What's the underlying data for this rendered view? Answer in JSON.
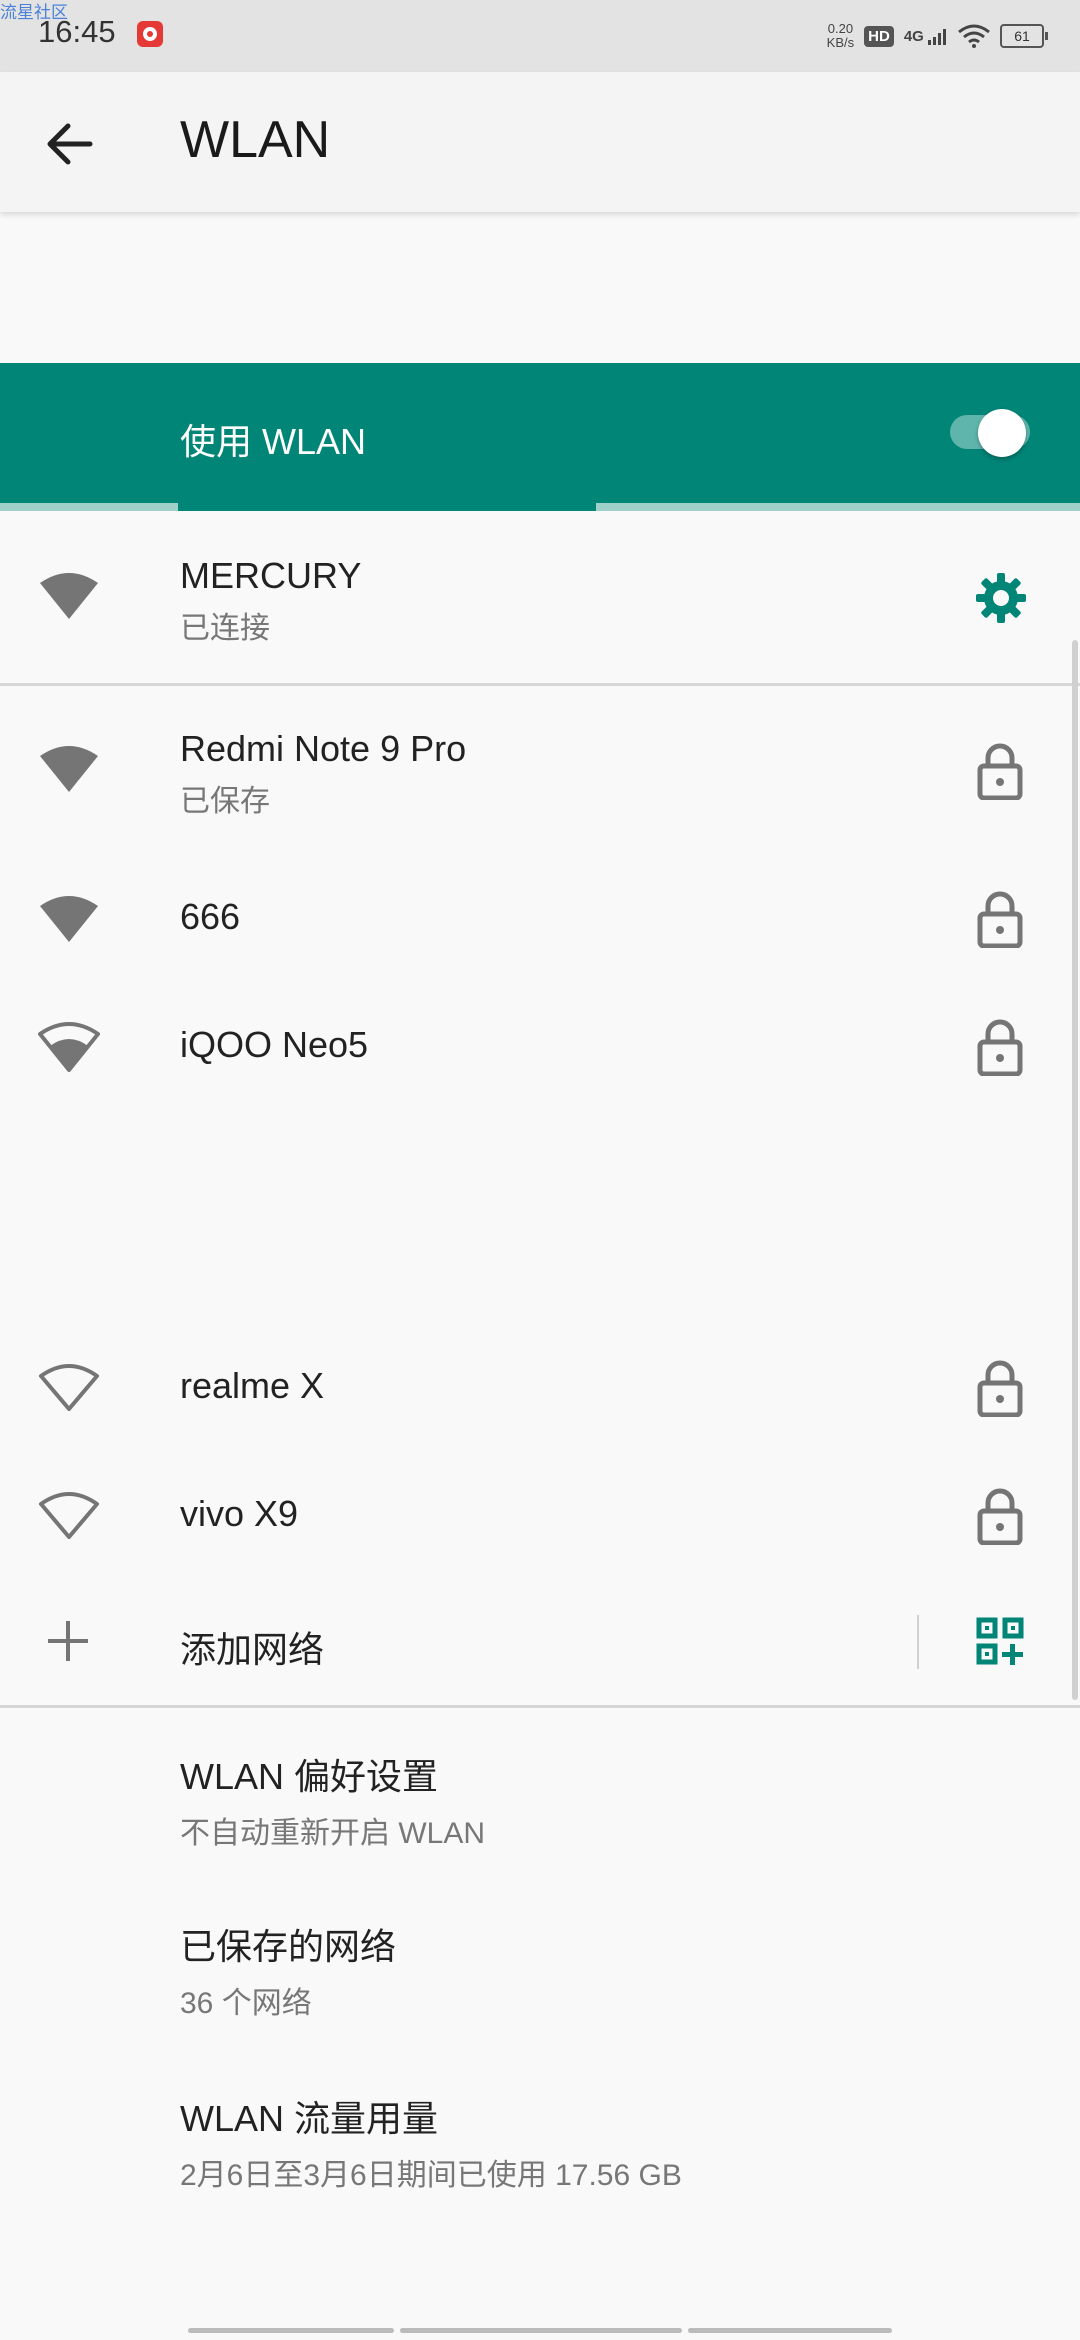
{
  "status_bar": {
    "watermark": "流星社区",
    "time": "16:45",
    "speed_value": "0.20",
    "speed_unit": "KB/s",
    "hd": "HD",
    "network": "4G",
    "battery": "61"
  },
  "app_bar": {
    "title": "WLAN"
  },
  "master_switch": {
    "label": "使用 WLAN",
    "enabled": true
  },
  "connected": {
    "name": "MERCURY",
    "status": "已连接"
  },
  "networks": [
    {
      "name": "Redmi Note 9 Pro",
      "status": "已保存",
      "signal": "full",
      "secured": true
    },
    {
      "name": "666",
      "status": "",
      "signal": "full",
      "secured": true
    },
    {
      "name": "iQOO Neo5",
      "status": "",
      "signal": "medium",
      "secured": true
    },
    {
      "name": "realme X",
      "status": "",
      "signal": "none",
      "secured": true
    },
    {
      "name": "vivo X9",
      "status": "",
      "signal": "none",
      "secured": true
    }
  ],
  "add_network": {
    "label": "添加网络"
  },
  "preferences": [
    {
      "title": "WLAN 偏好设置",
      "summary": "不自动重新开启 WLAN"
    },
    {
      "title": "已保存的网络",
      "summary": "36 个网络"
    },
    {
      "title": "WLAN 流量用量",
      "summary": "2月6日至3月6日期间已使用 17.56 GB"
    }
  ],
  "colors": {
    "accent": "#008577",
    "icon_gray": "#757575"
  }
}
